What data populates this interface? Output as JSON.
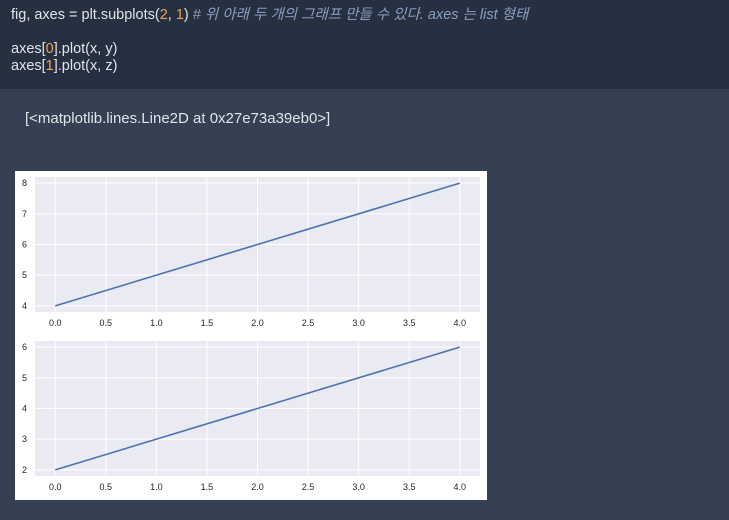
{
  "code": {
    "line1_prefix": "fig, axes = plt.subplots(",
    "line1_arg1": "2",
    "line1_sep": ", ",
    "line1_arg2": "1",
    "line1_close": ") ",
    "line1_comment": "# 위 아래 두 개의 그래프 만들 수 있다. axes 는 list 형태",
    "line2_prefix": "axes[",
    "line2_index": "0",
    "line2_suffix": "].plot(x, y)",
    "line3_prefix": "axes[",
    "line3_index": "1",
    "line3_suffix": "].plot(x, z)"
  },
  "output": {
    "text": "[<matplotlib.lines.Line2D at 0x27e73a39eb0>]"
  },
  "colors": {
    "line": "#4c72b0",
    "axes_bg": "#eaeaf2",
    "grid": "#ffffff"
  },
  "chart_data": [
    {
      "type": "line",
      "x": [
        0.0,
        4.0
      ],
      "series": [
        {
          "values": [
            4,
            8
          ]
        }
      ],
      "xticks": [
        "0.0",
        "0.5",
        "1.0",
        "1.5",
        "2.0",
        "2.5",
        "3.0",
        "3.5",
        "4.0"
      ],
      "yticks": [
        "4",
        "5",
        "6",
        "7",
        "8"
      ],
      "xlim": [
        -0.2,
        4.2
      ],
      "ylim": [
        3.8,
        8.2
      ],
      "grid": true
    },
    {
      "type": "line",
      "x": [
        0.0,
        4.0
      ],
      "series": [
        {
          "values": [
            2,
            6
          ]
        }
      ],
      "xticks": [
        "0.0",
        "0.5",
        "1.0",
        "1.5",
        "2.0",
        "2.5",
        "3.0",
        "3.5",
        "4.0"
      ],
      "yticks": [
        "2",
        "3",
        "4",
        "5",
        "6"
      ],
      "xlim": [
        -0.2,
        4.2
      ],
      "ylim": [
        1.8,
        6.2
      ],
      "grid": true
    }
  ]
}
